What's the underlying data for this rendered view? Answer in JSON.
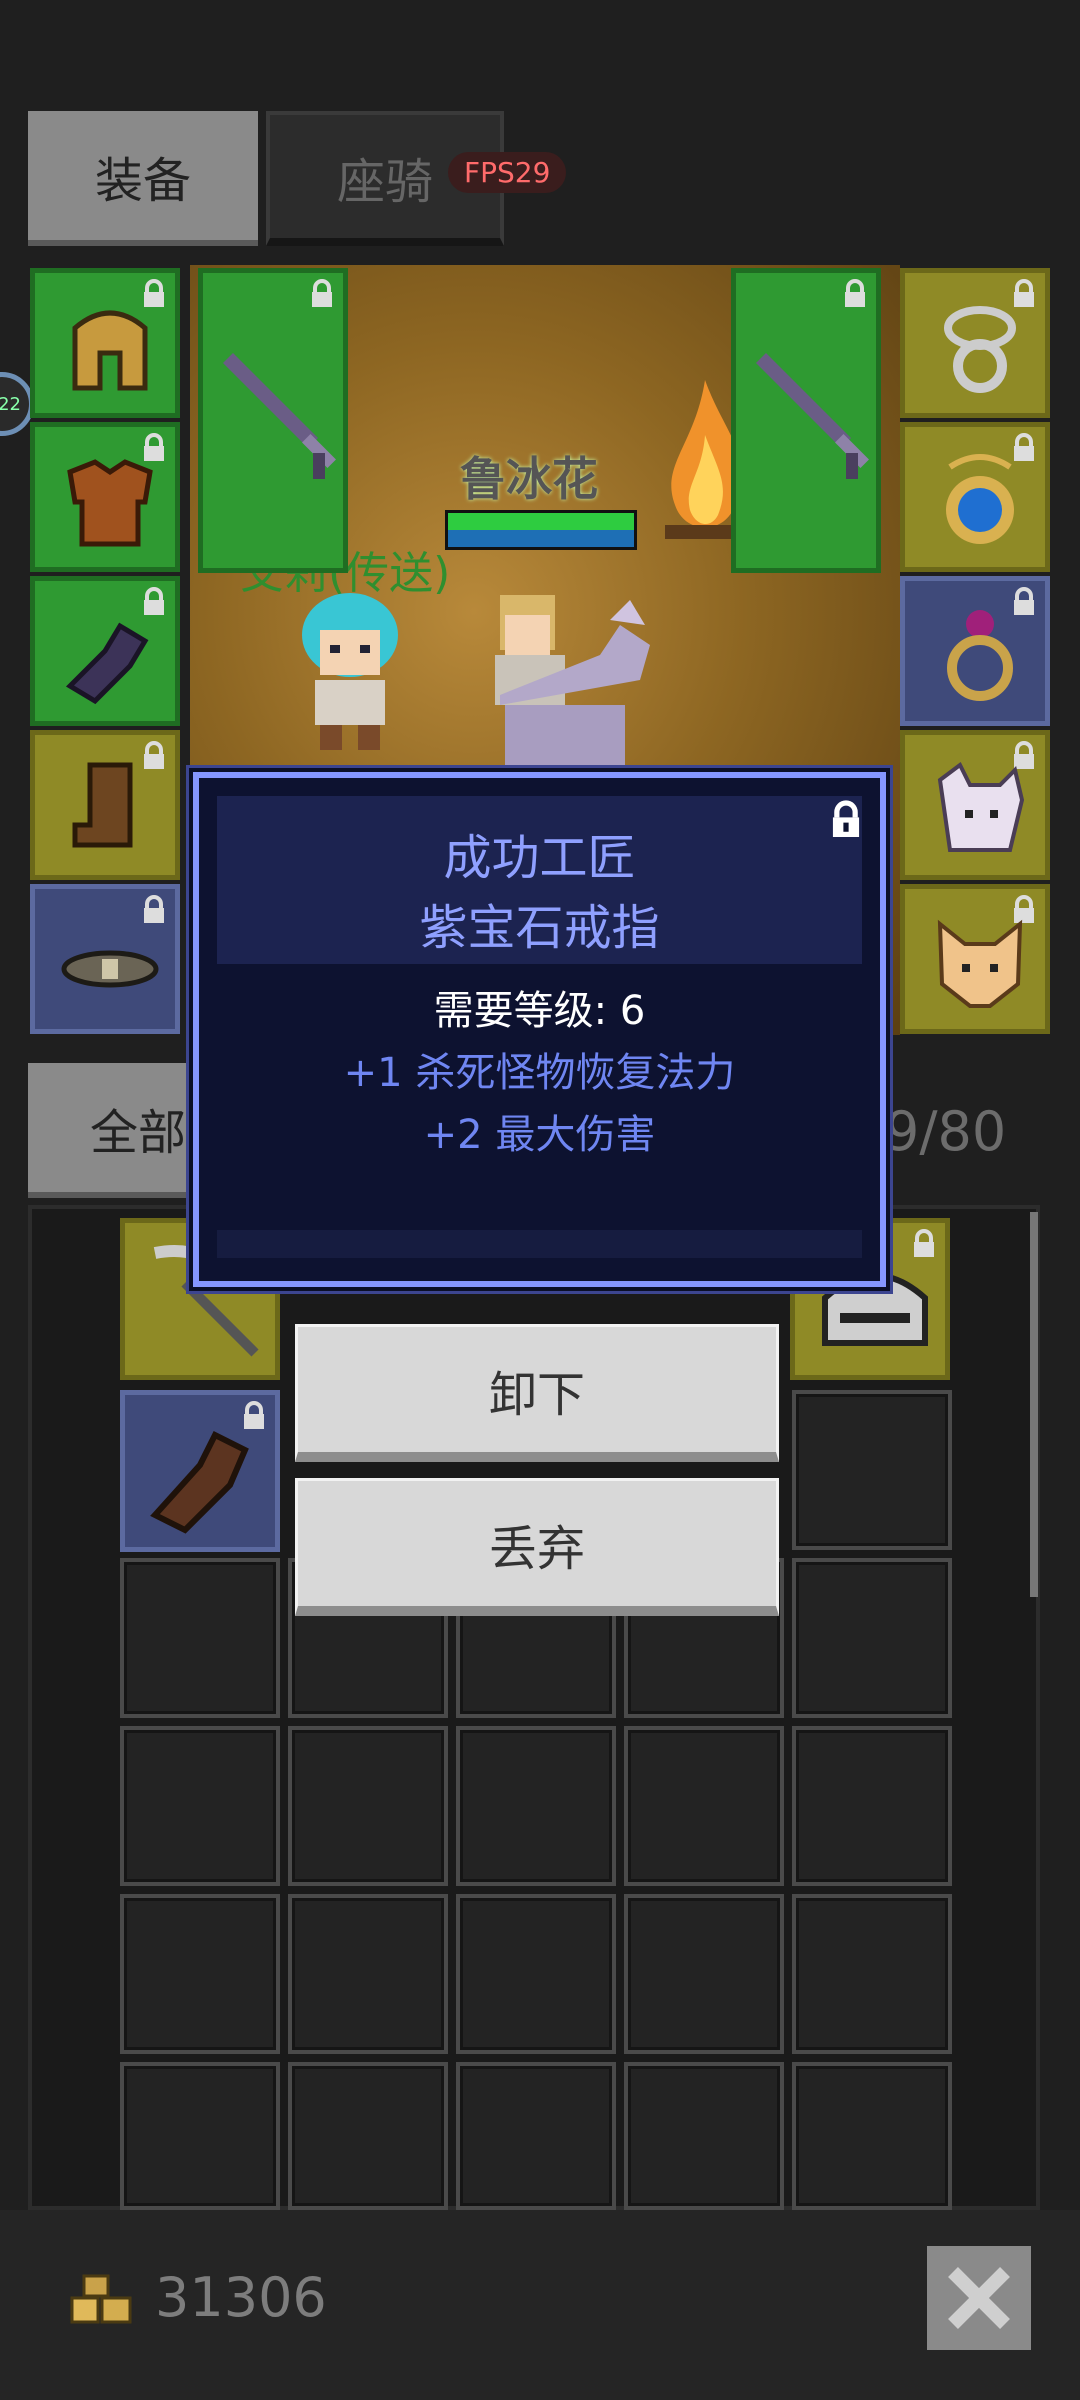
{
  "tabs": [
    {
      "label": "装备",
      "active": true
    },
    {
      "label": "座骑",
      "active": false
    }
  ],
  "fps_badge": "FPS29",
  "scene": {
    "player_name": "鲁冰花",
    "companion_label_partial": "艾莉(传送)",
    "hp_fraction": 1.0,
    "mp_fraction": 1.0,
    "side_circle_text": "22"
  },
  "equipment": {
    "left_slots": [
      {
        "icon": "helmet-icon",
        "color": "green"
      },
      {
        "icon": "armor-icon",
        "color": "green"
      },
      {
        "icon": "gauntlet-icon",
        "color": "green"
      },
      {
        "icon": "boots-icon",
        "color": "yellow"
      },
      {
        "icon": "belt-icon",
        "color": "blue"
      }
    ],
    "weapon_slots": [
      {
        "icon": "sword-icon",
        "color": "green"
      },
      {
        "icon": "sword-icon",
        "color": "green"
      }
    ],
    "right_slots": [
      {
        "icon": "ring-icon",
        "color": "yellow"
      },
      {
        "icon": "amulet-icon",
        "color": "yellow"
      },
      {
        "icon": "amethyst-ring-icon",
        "color": "blue"
      },
      {
        "icon": "pet-wolf-icon",
        "color": "yellow"
      },
      {
        "icon": "pet-fox-icon",
        "color": "yellow"
      }
    ]
  },
  "filter_button_label": "全部",
  "inventory_count": "9/80",
  "tooltip": {
    "quality_prefix": "成功工匠",
    "item_name": "紫宝石戒指",
    "requirement": "需要等级: 6",
    "stats": [
      "+1 杀死怪物恢复法力",
      "+2 最大伤害"
    ]
  },
  "actions": {
    "unequip_label": "卸下",
    "discard_label": "丢弃"
  },
  "gold": "31306",
  "colors": {
    "tooltip_title": "#8fa0ff",
    "tooltip_stat": "#6f86f2",
    "slot_green": "#2f9a32",
    "slot_yellow": "#8f8a26",
    "slot_blue": "#3f4a7a"
  }
}
